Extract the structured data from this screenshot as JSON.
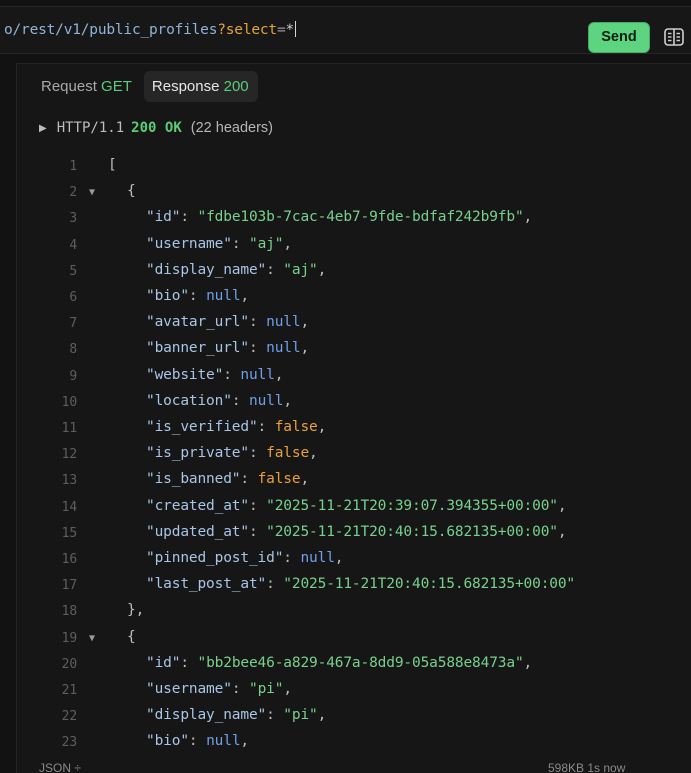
{
  "request": {
    "url_path": "o/rest/v1/public_profiles",
    "url_query_mark": "?",
    "url_query_key": "select",
    "url_query_eq": "=",
    "url_query_value": "*",
    "send_label": "Send",
    "side_icon": "sidebar-layout-icon"
  },
  "tabs": [
    {
      "label": "Request",
      "meta": "GET"
    },
    {
      "label": "Response",
      "meta": "200"
    }
  ],
  "status": {
    "protocol": "HTTP/1.1",
    "code": "200 OK",
    "headers": "(22 headers)"
  },
  "response_lines": [
    {
      "n": "1",
      "fold": false,
      "indent": 0,
      "parts": [
        {
          "t": "[",
          "c": "p"
        }
      ]
    },
    {
      "n": "2",
      "fold": true,
      "indent": 1,
      "parts": [
        {
          "t": "{",
          "c": "p"
        }
      ]
    },
    {
      "n": "3",
      "fold": false,
      "indent": 2,
      "parts": [
        {
          "t": "\"id\"",
          "c": "k"
        },
        {
          "t": ": ",
          "c": "p"
        },
        {
          "t": "\"fdbe103b-7cac-4eb7-9fde-bdfaf242b9fb\"",
          "c": "s"
        },
        {
          "t": ",",
          "c": "p"
        }
      ]
    },
    {
      "n": "4",
      "fold": false,
      "indent": 2,
      "parts": [
        {
          "t": "\"username\"",
          "c": "k"
        },
        {
          "t": ": ",
          "c": "p"
        },
        {
          "t": "\"aj\"",
          "c": "s"
        },
        {
          "t": ",",
          "c": "p"
        }
      ]
    },
    {
      "n": "5",
      "fold": false,
      "indent": 2,
      "parts": [
        {
          "t": "\"display_name\"",
          "c": "k"
        },
        {
          "t": ": ",
          "c": "p"
        },
        {
          "t": "\"aj\"",
          "c": "s"
        },
        {
          "t": ",",
          "c": "p"
        }
      ]
    },
    {
      "n": "6",
      "fold": false,
      "indent": 2,
      "parts": [
        {
          "t": "\"bio\"",
          "c": "k"
        },
        {
          "t": ": ",
          "c": "p"
        },
        {
          "t": "null",
          "c": "n"
        },
        {
          "t": ",",
          "c": "p"
        }
      ]
    },
    {
      "n": "7",
      "fold": false,
      "indent": 2,
      "parts": [
        {
          "t": "\"avatar_url\"",
          "c": "k"
        },
        {
          "t": ": ",
          "c": "p"
        },
        {
          "t": "null",
          "c": "n"
        },
        {
          "t": ",",
          "c": "p"
        }
      ]
    },
    {
      "n": "8",
      "fold": false,
      "indent": 2,
      "parts": [
        {
          "t": "\"banner_url\"",
          "c": "k"
        },
        {
          "t": ": ",
          "c": "p"
        },
        {
          "t": "null",
          "c": "n"
        },
        {
          "t": ",",
          "c": "p"
        }
      ]
    },
    {
      "n": "9",
      "fold": false,
      "indent": 2,
      "parts": [
        {
          "t": "\"website\"",
          "c": "k"
        },
        {
          "t": ": ",
          "c": "p"
        },
        {
          "t": "null",
          "c": "n"
        },
        {
          "t": ",",
          "c": "p"
        }
      ]
    },
    {
      "n": "10",
      "fold": false,
      "indent": 2,
      "parts": [
        {
          "t": "\"location\"",
          "c": "k"
        },
        {
          "t": ": ",
          "c": "p"
        },
        {
          "t": "null",
          "c": "n"
        },
        {
          "t": ",",
          "c": "p"
        }
      ]
    },
    {
      "n": "11",
      "fold": false,
      "indent": 2,
      "parts": [
        {
          "t": "\"is_verified\"",
          "c": "k"
        },
        {
          "t": ": ",
          "c": "p"
        },
        {
          "t": "false",
          "c": "b"
        },
        {
          "t": ",",
          "c": "p"
        }
      ]
    },
    {
      "n": "12",
      "fold": false,
      "indent": 2,
      "parts": [
        {
          "t": "\"is_private\"",
          "c": "k"
        },
        {
          "t": ": ",
          "c": "p"
        },
        {
          "t": "false",
          "c": "b"
        },
        {
          "t": ",",
          "c": "p"
        }
      ]
    },
    {
      "n": "13",
      "fold": false,
      "indent": 2,
      "parts": [
        {
          "t": "\"is_banned\"",
          "c": "k"
        },
        {
          "t": ": ",
          "c": "p"
        },
        {
          "t": "false",
          "c": "b"
        },
        {
          "t": ",",
          "c": "p"
        }
      ]
    },
    {
      "n": "14",
      "fold": false,
      "indent": 2,
      "parts": [
        {
          "t": "\"created_at\"",
          "c": "k"
        },
        {
          "t": ": ",
          "c": "p"
        },
        {
          "t": "\"2025-11-21T20:39:07.394355+00:00\"",
          "c": "s"
        },
        {
          "t": ",",
          "c": "p"
        }
      ]
    },
    {
      "n": "15",
      "fold": false,
      "indent": 2,
      "parts": [
        {
          "t": "\"updated_at\"",
          "c": "k"
        },
        {
          "t": ": ",
          "c": "p"
        },
        {
          "t": "\"2025-11-21T20:40:15.682135+00:00\"",
          "c": "s"
        },
        {
          "t": ",",
          "c": "p"
        }
      ]
    },
    {
      "n": "16",
      "fold": false,
      "indent": 2,
      "parts": [
        {
          "t": "\"pinned_post_id\"",
          "c": "k"
        },
        {
          "t": ": ",
          "c": "p"
        },
        {
          "t": "null",
          "c": "n"
        },
        {
          "t": ",",
          "c": "p"
        }
      ]
    },
    {
      "n": "17",
      "fold": false,
      "indent": 2,
      "parts": [
        {
          "t": "\"last_post_at\"",
          "c": "k"
        },
        {
          "t": ": ",
          "c": "p"
        },
        {
          "t": "\"2025-11-21T20:40:15.682135+00:00\"",
          "c": "s"
        }
      ]
    },
    {
      "n": "18",
      "fold": false,
      "indent": 1,
      "parts": [
        {
          "t": "},",
          "c": "p"
        }
      ]
    },
    {
      "n": "19",
      "fold": true,
      "indent": 1,
      "parts": [
        {
          "t": "{",
          "c": "p"
        }
      ]
    },
    {
      "n": "20",
      "fold": false,
      "indent": 2,
      "parts": [
        {
          "t": "\"id\"",
          "c": "k"
        },
        {
          "t": ": ",
          "c": "p"
        },
        {
          "t": "\"bb2bee46-a829-467a-8dd9-05a588e8473a\"",
          "c": "s"
        },
        {
          "t": ",",
          "c": "p"
        }
      ]
    },
    {
      "n": "21",
      "fold": false,
      "indent": 2,
      "parts": [
        {
          "t": "\"username\"",
          "c": "k"
        },
        {
          "t": ": ",
          "c": "p"
        },
        {
          "t": "\"pi\"",
          "c": "s"
        },
        {
          "t": ",",
          "c": "p"
        }
      ]
    },
    {
      "n": "22",
      "fold": false,
      "indent": 2,
      "parts": [
        {
          "t": "\"display_name\"",
          "c": "k"
        },
        {
          "t": ": ",
          "c": "p"
        },
        {
          "t": "\"pi\"",
          "c": "s"
        },
        {
          "t": ",",
          "c": "p"
        }
      ]
    },
    {
      "n": "23",
      "fold": false,
      "indent": 2,
      "parts": [
        {
          "t": "\"bio\"",
          "c": "k"
        },
        {
          "t": ": ",
          "c": "p"
        },
        {
          "t": "null",
          "c": "n"
        },
        {
          "t": ",",
          "c": "p"
        }
      ]
    }
  ],
  "footer": {
    "format": "JSON ÷",
    "meta": "598KB 1s now"
  },
  "colors": {
    "accent_green": "#5dd47f",
    "json_key": "#a8c4e6",
    "json_string": "#77d18c",
    "json_null": "#6fa0e8",
    "json_bool": "#e9a03b"
  }
}
